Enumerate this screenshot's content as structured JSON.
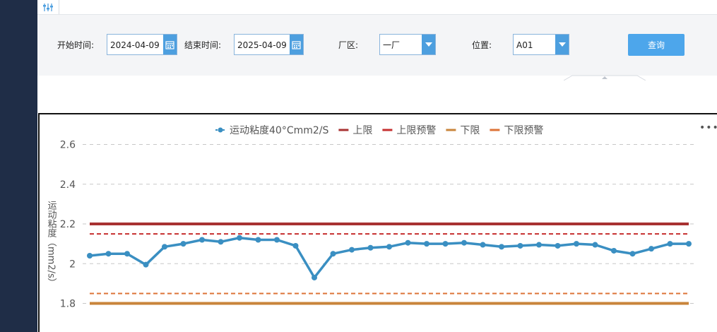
{
  "filters": {
    "start_label": "开始时间:",
    "start_value": "2024-04-09",
    "end_label": "结束时间:",
    "end_value": "2025-04-09",
    "area_label": "厂区:",
    "area_value": "一厂",
    "position_label": "位置:",
    "position_value": "A01",
    "query_label": "查询"
  },
  "icons": {
    "tab": "sliders-icon",
    "calendar": "calendar-icon",
    "dropdown": "chevron-down-icon",
    "more": "more-horizontal-icon",
    "collapse": "caret-up-icon"
  },
  "colors": {
    "sidebar": "#1f2d47",
    "accent": "#4d9fdf",
    "series_main": "#3a8fc2",
    "upper_limit": "#a83232",
    "upper_warning": "#c62f2f",
    "lower_limit": "#c9853b",
    "lower_warning": "#dd7337"
  },
  "chart_data": {
    "type": "line",
    "title": "",
    "ylabel": "运动粘度（mm2/s）",
    "ylim": [
      1.8,
      2.6
    ],
    "yticks": [
      "1.8",
      "2",
      "2.2",
      "2.4",
      "2.6"
    ],
    "grid": true,
    "legend_position": "top-center",
    "legend": [
      "运动粘度40°Cmm2/S",
      "上限",
      "上限预警",
      "下限",
      "下限预警"
    ],
    "series": [
      {
        "name": "运动粘度40°Cmm2/S",
        "values": [
          2.04,
          2.05,
          2.05,
          1.995,
          2.085,
          2.1,
          2.12,
          2.11,
          2.13,
          2.12,
          2.12,
          2.09,
          1.93,
          2.05,
          2.07,
          2.08,
          2.085,
          2.105,
          2.1,
          2.1,
          2.105,
          2.095,
          2.085,
          2.09,
          2.095,
          2.09,
          2.1,
          2.095,
          2.065,
          2.05,
          2.075,
          2.1,
          2.1
        ]
      },
      {
        "name": "上限",
        "constant": 2.2
      },
      {
        "name": "上限预警",
        "constant": 2.15
      },
      {
        "name": "下限",
        "constant": 1.8
      },
      {
        "name": "下限预警",
        "constant": 1.85
      }
    ]
  }
}
